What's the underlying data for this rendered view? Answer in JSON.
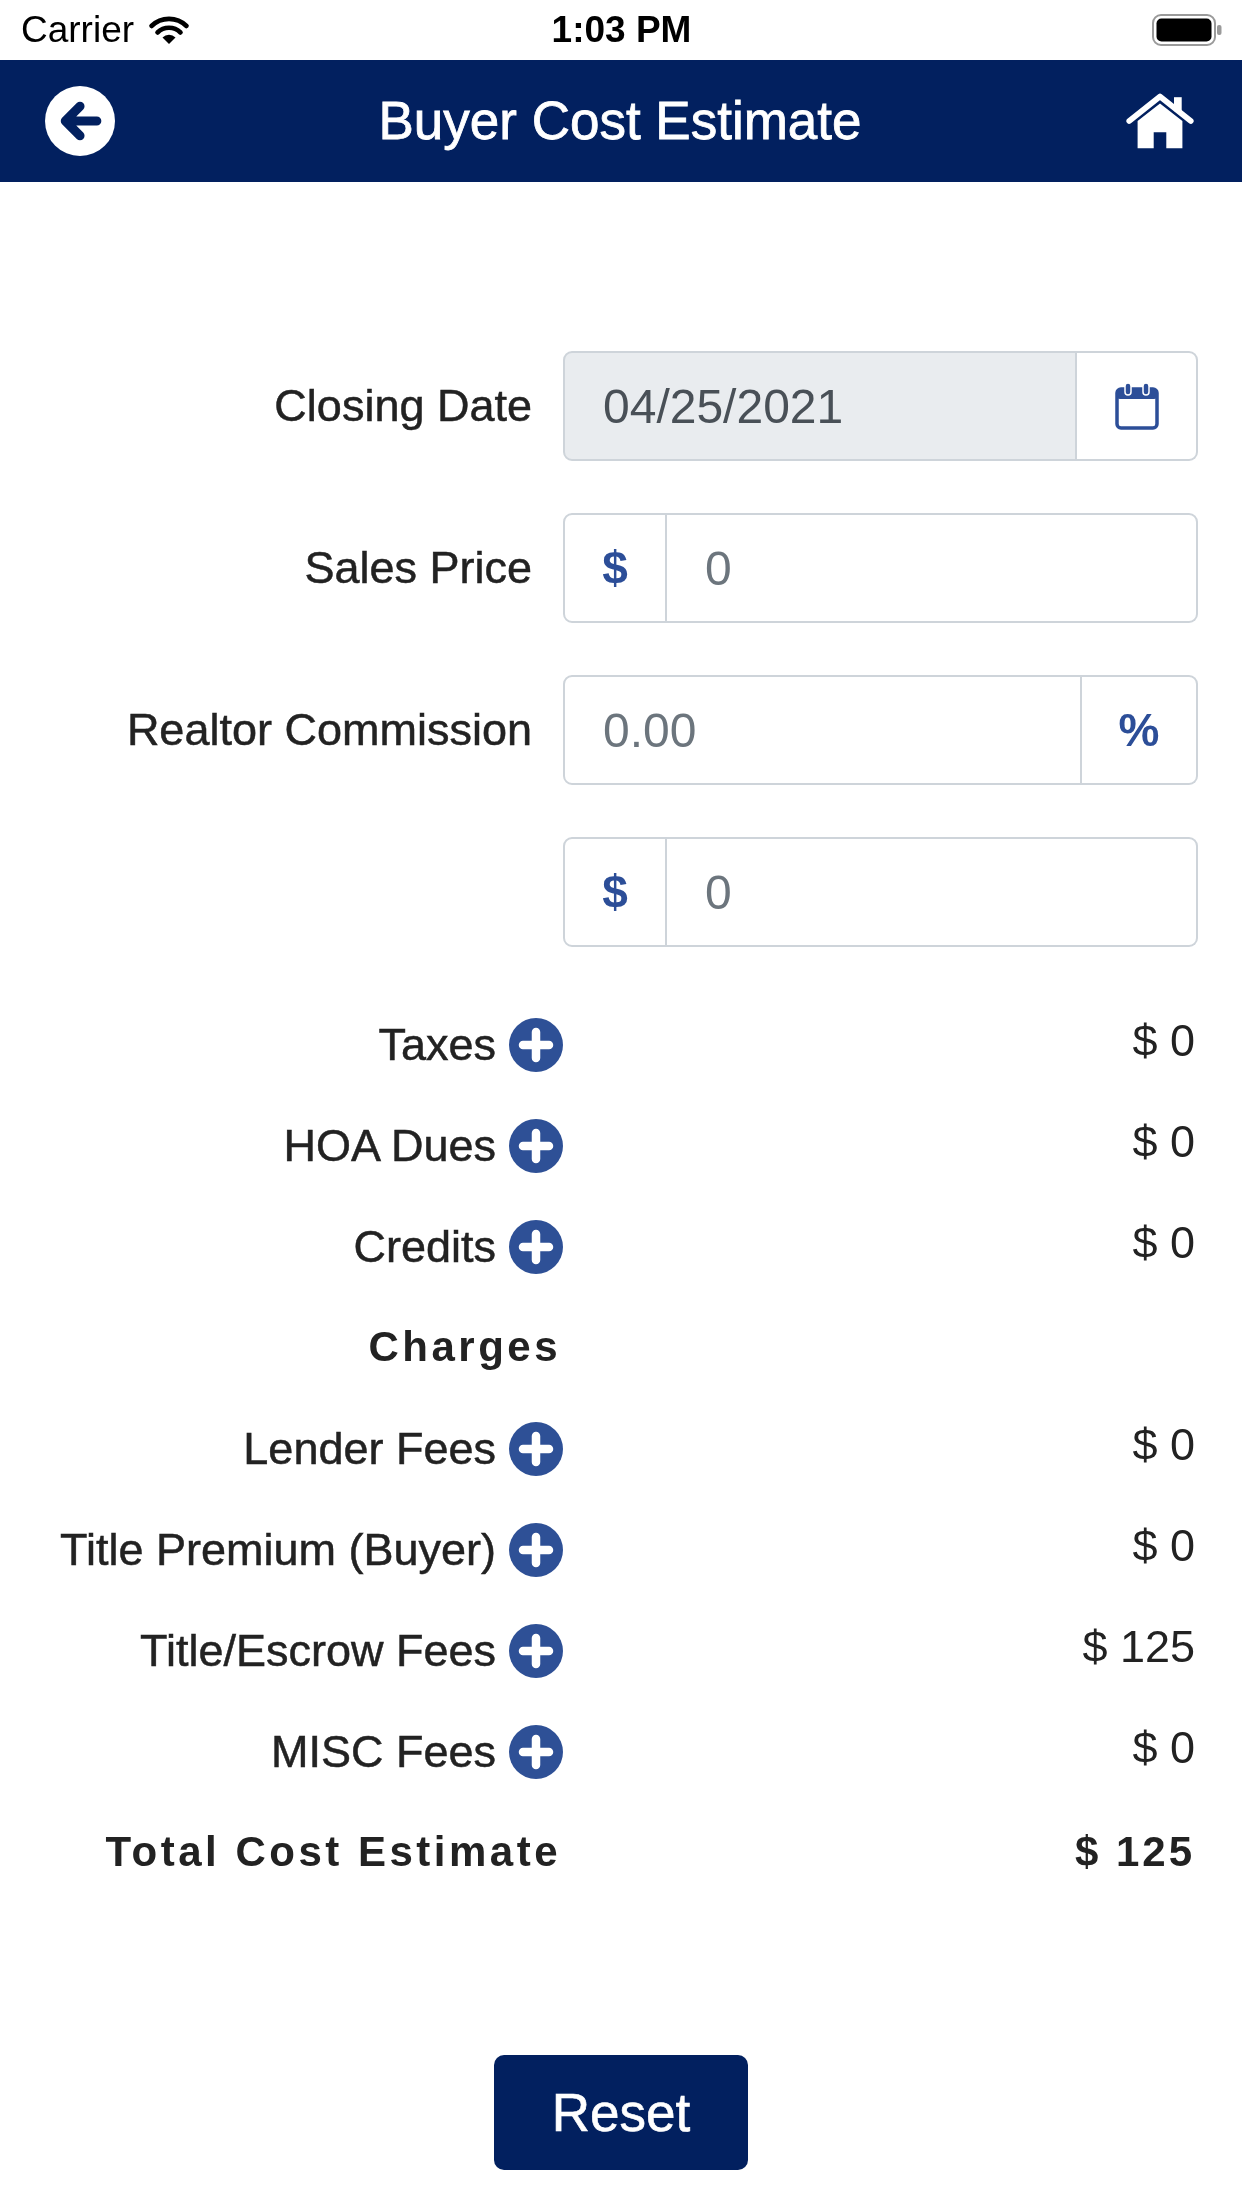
{
  "status_bar": {
    "carrier": "Carrier",
    "time": "1:03 PM"
  },
  "nav_bar": {
    "title": "Buyer Cost Estimate"
  },
  "form": {
    "fields": [
      {
        "kind": "date",
        "label": "Closing Date",
        "value": "04/25/2021",
        "disabled": true
      },
      {
        "kind": "currency",
        "label": "Sales Price",
        "prefix": "$",
        "placeholder": "0",
        "disabled": false
      },
      {
        "kind": "percent",
        "label": "Realtor Commission",
        "placeholder": "0.00",
        "suffix": "%",
        "disabled": false
      },
      {
        "kind": "currency",
        "prefix": "$",
        "placeholder": "0",
        "disabled": false
      }
    ]
  },
  "summary": {
    "rows": [
      {
        "kind": "item",
        "label": "Taxes",
        "amount": "$ 0"
      },
      {
        "kind": "item",
        "label": "HOA Dues",
        "amount": "$ 0"
      },
      {
        "kind": "item",
        "label": "Credits",
        "amount": "$ 0"
      },
      {
        "kind": "heading",
        "label": "Charges"
      },
      {
        "kind": "item",
        "label": "Lender Fees",
        "amount": "$ 0"
      },
      {
        "kind": "item",
        "label": "Title Premium (Buyer)",
        "amount": "$ 0"
      },
      {
        "kind": "item",
        "label": "Title/Escrow Fees",
        "amount": "$ 125"
      },
      {
        "kind": "item",
        "label": "MISC Fees",
        "amount": "$ 0"
      },
      {
        "kind": "total",
        "label": "Total Cost Estimate",
        "amount": "$ 125"
      }
    ]
  },
  "reset_button": {
    "label": "Reset"
  }
}
